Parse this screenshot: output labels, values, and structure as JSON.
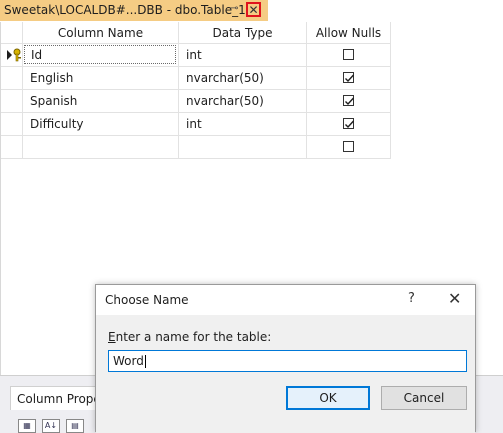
{
  "tab": {
    "title": "Sweetak\\LOCALDB#...DBB - dbo.Table_1*",
    "pin_glyph": "⊸",
    "close_glyph": "✕"
  },
  "grid": {
    "headers": [
      "Column Name",
      "Data Type",
      "Allow Nulls"
    ],
    "rows": [
      {
        "name": "Id",
        "type": "int",
        "allow_nulls": false,
        "primary_key": true
      },
      {
        "name": "English",
        "type": "nvarchar(50)",
        "allow_nulls": true,
        "primary_key": false
      },
      {
        "name": "Spanish",
        "type": "nvarchar(50)",
        "allow_nulls": true,
        "primary_key": false
      },
      {
        "name": "Difficulty",
        "type": "int",
        "allow_nulls": true,
        "primary_key": false
      },
      {
        "name": "",
        "type": "",
        "allow_nulls": false,
        "primary_key": false
      }
    ]
  },
  "properties": {
    "tab_label": "Column Properties"
  },
  "dialog": {
    "title": "Choose Name",
    "help_glyph": "?",
    "close_glyph": "✕",
    "prompt_accesskey": "E",
    "prompt_rest": "nter a name for the table:",
    "input_value": "Word",
    "ok_label": "OK",
    "cancel_label": "Cancel"
  },
  "colors": {
    "tab_active": "#f5cc84",
    "close_highlight": "#e0141e",
    "focus": "#0078d7"
  }
}
